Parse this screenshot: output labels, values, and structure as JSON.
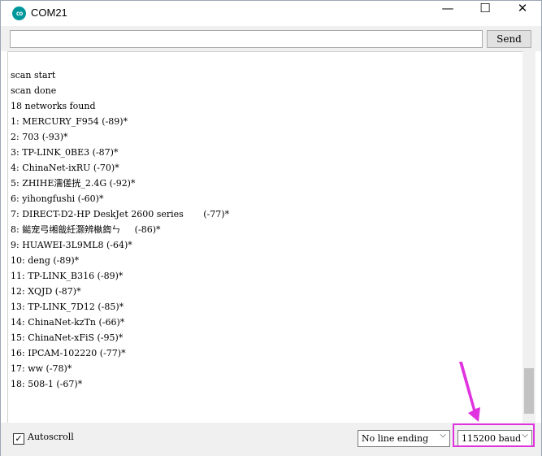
{
  "window": {
    "title": "COM21",
    "minimize": "—",
    "maximize": "☐",
    "close": "✕",
    "icon": "arduino-icon"
  },
  "send": {
    "input_value": "",
    "button_label": "Send"
  },
  "output": {
    "lines": [
      "scan start",
      "scan done",
      "18 networks found",
      "1: MERCURY_F954 (-89)*",
      "2: 703 (-93)*",
      "3: TP-LINK_0BE3 (-87)*",
      "4: ChinaNet-ixRU (-70)*",
      "5: ZHIHE濡傞挄_2.4G (-92)*",
      "6: yihongfushi (-60)*",
      "7: DIRECT-D2-HP DeskJet 2600 series       (-77)*",
      "8: 鐑宠弓缃戠紝灏辨槸鍧ㄣ     (-86)*",
      "9: HUAWEI-3L9ML8 (-64)*",
      "10: deng (-89)*",
      "11: TP-LINK_B316 (-89)*",
      "12: XQJD (-87)*",
      "13: TP-LINK_7D12 (-85)*",
      "14: ChinaNet-kzTn (-66)*",
      "15: ChinaNet-xFiS (-95)*",
      "16: IPCAM-102220 (-77)*",
      "17: ww (-78)*",
      "18: 508-1 (-67)*"
    ]
  },
  "footer": {
    "autoscroll_label": "Autoscroll",
    "autoscroll_checked": true,
    "line_ending": "No line ending",
    "baud": "115200 baud"
  },
  "colors": {
    "highlight": "#e033e0",
    "arrow": "#e033e0"
  }
}
